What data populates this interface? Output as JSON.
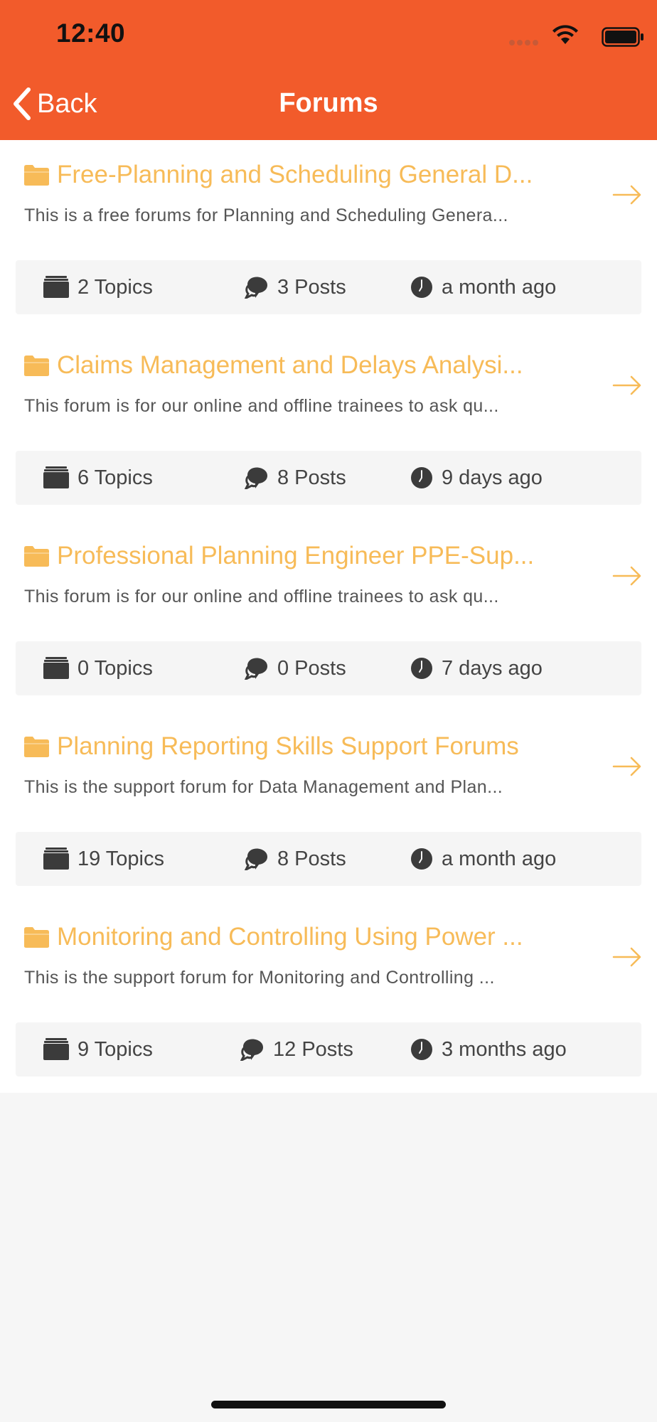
{
  "status_bar": {
    "time": "12:40"
  },
  "nav": {
    "back_label": "Back",
    "title": "Forums"
  },
  "colors": {
    "accent": "#f25b2b",
    "forum_title": "#f7bb58"
  },
  "forums": [
    {
      "title": "Free-Planning and Scheduling General D...",
      "description": "This is a free forums for Planning and Scheduling Genera...",
      "topics": "2 Topics",
      "posts": "3 Posts",
      "last_activity": "a month ago"
    },
    {
      "title": "Claims Management and Delays Analysi...",
      "description": "This forum is for our online and offline trainees to ask qu...",
      "topics": "6 Topics",
      "posts": "8 Posts",
      "last_activity": "9 days ago"
    },
    {
      "title": "Professional Planning Engineer PPE-Sup...",
      "description": "This forum is for our online and offline trainees to ask qu...",
      "topics": "0 Topics",
      "posts": "0 Posts",
      "last_activity": "7 days ago"
    },
    {
      "title": "Planning Reporting Skills Support Forums",
      "description": "This is the support forum for Data Management and Plan...",
      "topics": "19 Topics",
      "posts": "8 Posts",
      "last_activity": "a month ago"
    },
    {
      "title": "Monitoring and Controlling Using Power ...",
      "description": "This is the support forum for Monitoring and Controlling ...",
      "topics": "9 Topics",
      "posts": "12 Posts",
      "last_activity": "3 months ago"
    }
  ]
}
